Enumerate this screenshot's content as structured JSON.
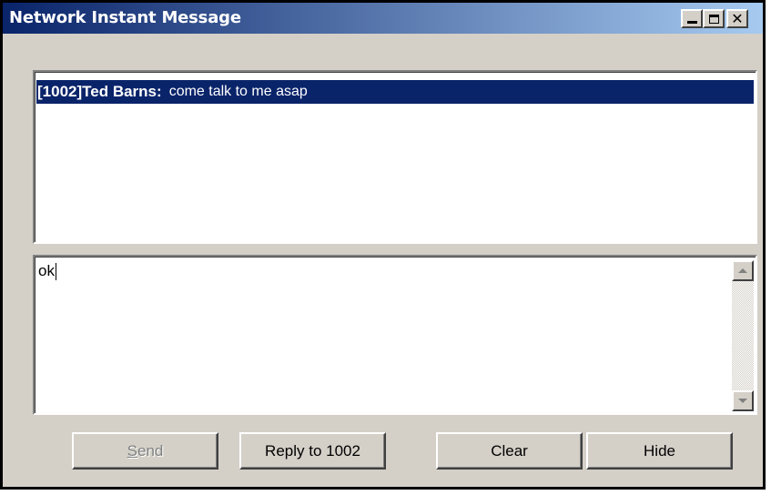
{
  "window": {
    "title": "Network Instant Message",
    "controls": {
      "minimize_icon": "minimize-icon",
      "maximize_icon": "maximize-icon",
      "close_icon": "close-icon"
    }
  },
  "message_list": {
    "items": [
      {
        "sender": "[1002]Ted Barns:",
        "text": "come talk to me asap",
        "selected": true
      }
    ]
  },
  "compose": {
    "value": "ok"
  },
  "buttons": {
    "send_label_underlined": "S",
    "send_label_rest": "end",
    "send_enabled": false,
    "reply_label": "Reply to 1002",
    "clear_label": "Clear",
    "hide_label": "Hide"
  },
  "colors": {
    "titlebar_start": "#0a246a",
    "titlebar_end": "#a6caf0",
    "selection": "#0a246a",
    "face": "#d4d0c8"
  }
}
